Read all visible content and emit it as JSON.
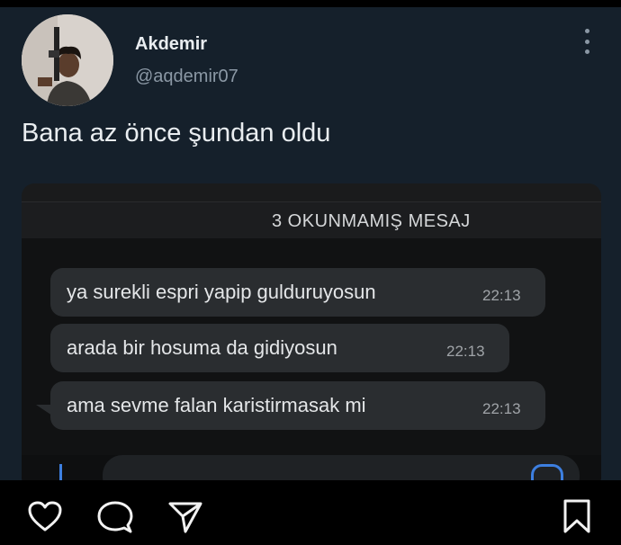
{
  "tweet": {
    "author_name": "Akdemir",
    "author_handle": "@aqdemir07",
    "text": "Bana az önce şundan oldu"
  },
  "chat": {
    "unread_label": "3 OKUNMAMIŞ MESAJ",
    "messages": [
      {
        "text": "ya surekli espri yapip gulduruyosun",
        "time": "22:13"
      },
      {
        "text": "arada bir hosuma da gidiyosun",
        "time": "22:13"
      },
      {
        "text": "ama sevme falan karistirmasak mi",
        "time": "22:13"
      }
    ]
  },
  "icons": {
    "more": "more-vertical-icon",
    "like": "heart-icon",
    "comment": "comment-icon",
    "share": "send-icon",
    "save": "bookmark-icon"
  },
  "colors": {
    "background": "#15202b",
    "chat_bubble": "#2a2d30",
    "accent": "#3d7fe0"
  }
}
